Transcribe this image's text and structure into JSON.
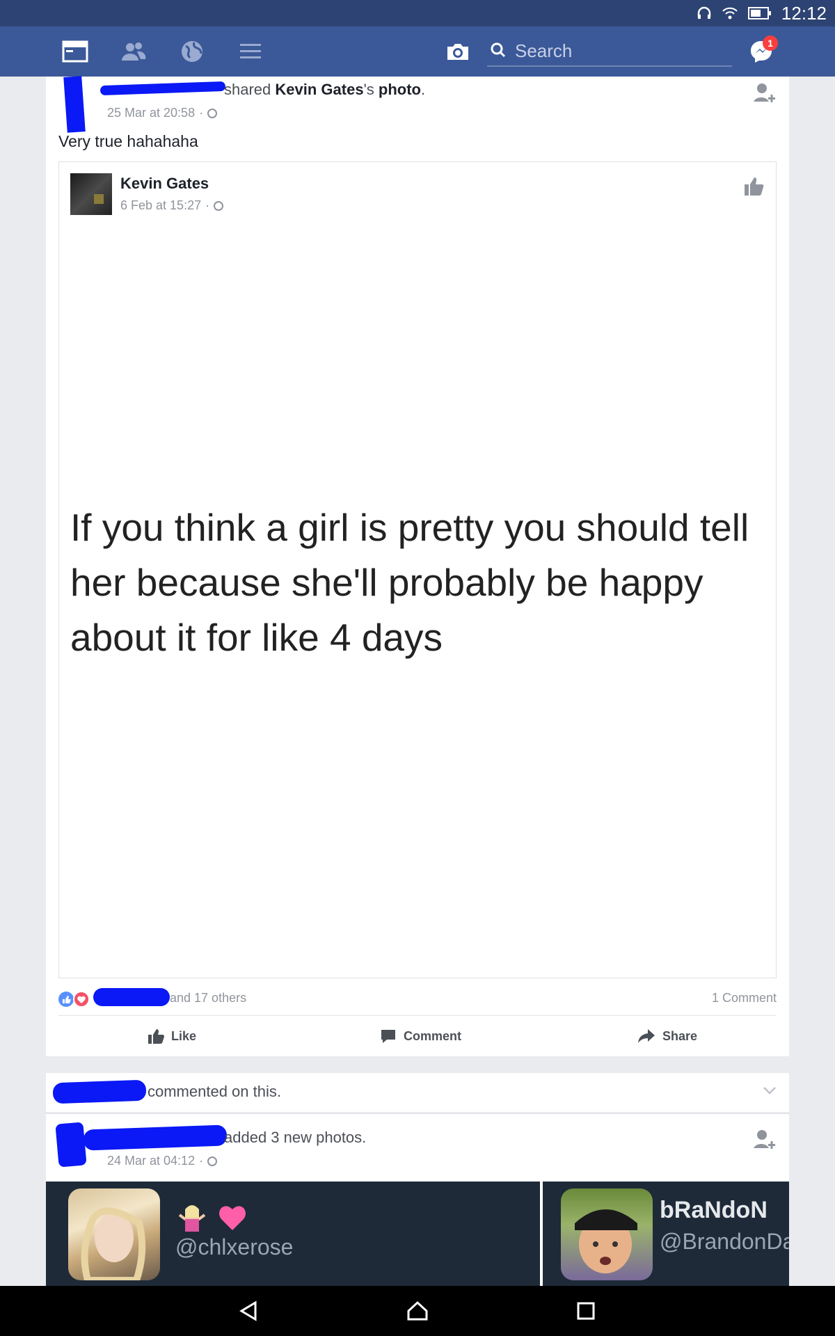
{
  "status_bar": {
    "time": "12:12"
  },
  "nav": {
    "search_placeholder": "Search",
    "messages_badge": "1",
    "colors": {
      "bar": "#3b5998",
      "status": "#2d4373",
      "badge": "#fa3e3e"
    }
  },
  "post": {
    "header_suffix": "shared ",
    "shared_author": "Kevin Gates",
    "possessive": "'s ",
    "object": "photo",
    "period": ".",
    "timestamp": "25 Mar at 20:58",
    "caption": "Very true hahahaha",
    "shared": {
      "author": "Kevin Gates",
      "timestamp": "6 Feb at 15:27",
      "photo_text": "If you think a girl is pretty you should tell her because she'll probably be happy about it for like 4 days"
    },
    "reactions_text": "and 17 others",
    "comment_count": "1 Comment",
    "actions": {
      "like": "Like",
      "comment": "Comment",
      "share": "Share"
    }
  },
  "notice": {
    "text": "commented on this."
  },
  "photos_post": {
    "header_text": "added 3 new photos.",
    "timestamp": "24 Mar at 04:12",
    "tiles": [
      {
        "handle": "@chlxerose"
      },
      {
        "name": "bRaNdoN",
        "handle": "@BrandonDa"
      }
    ]
  }
}
